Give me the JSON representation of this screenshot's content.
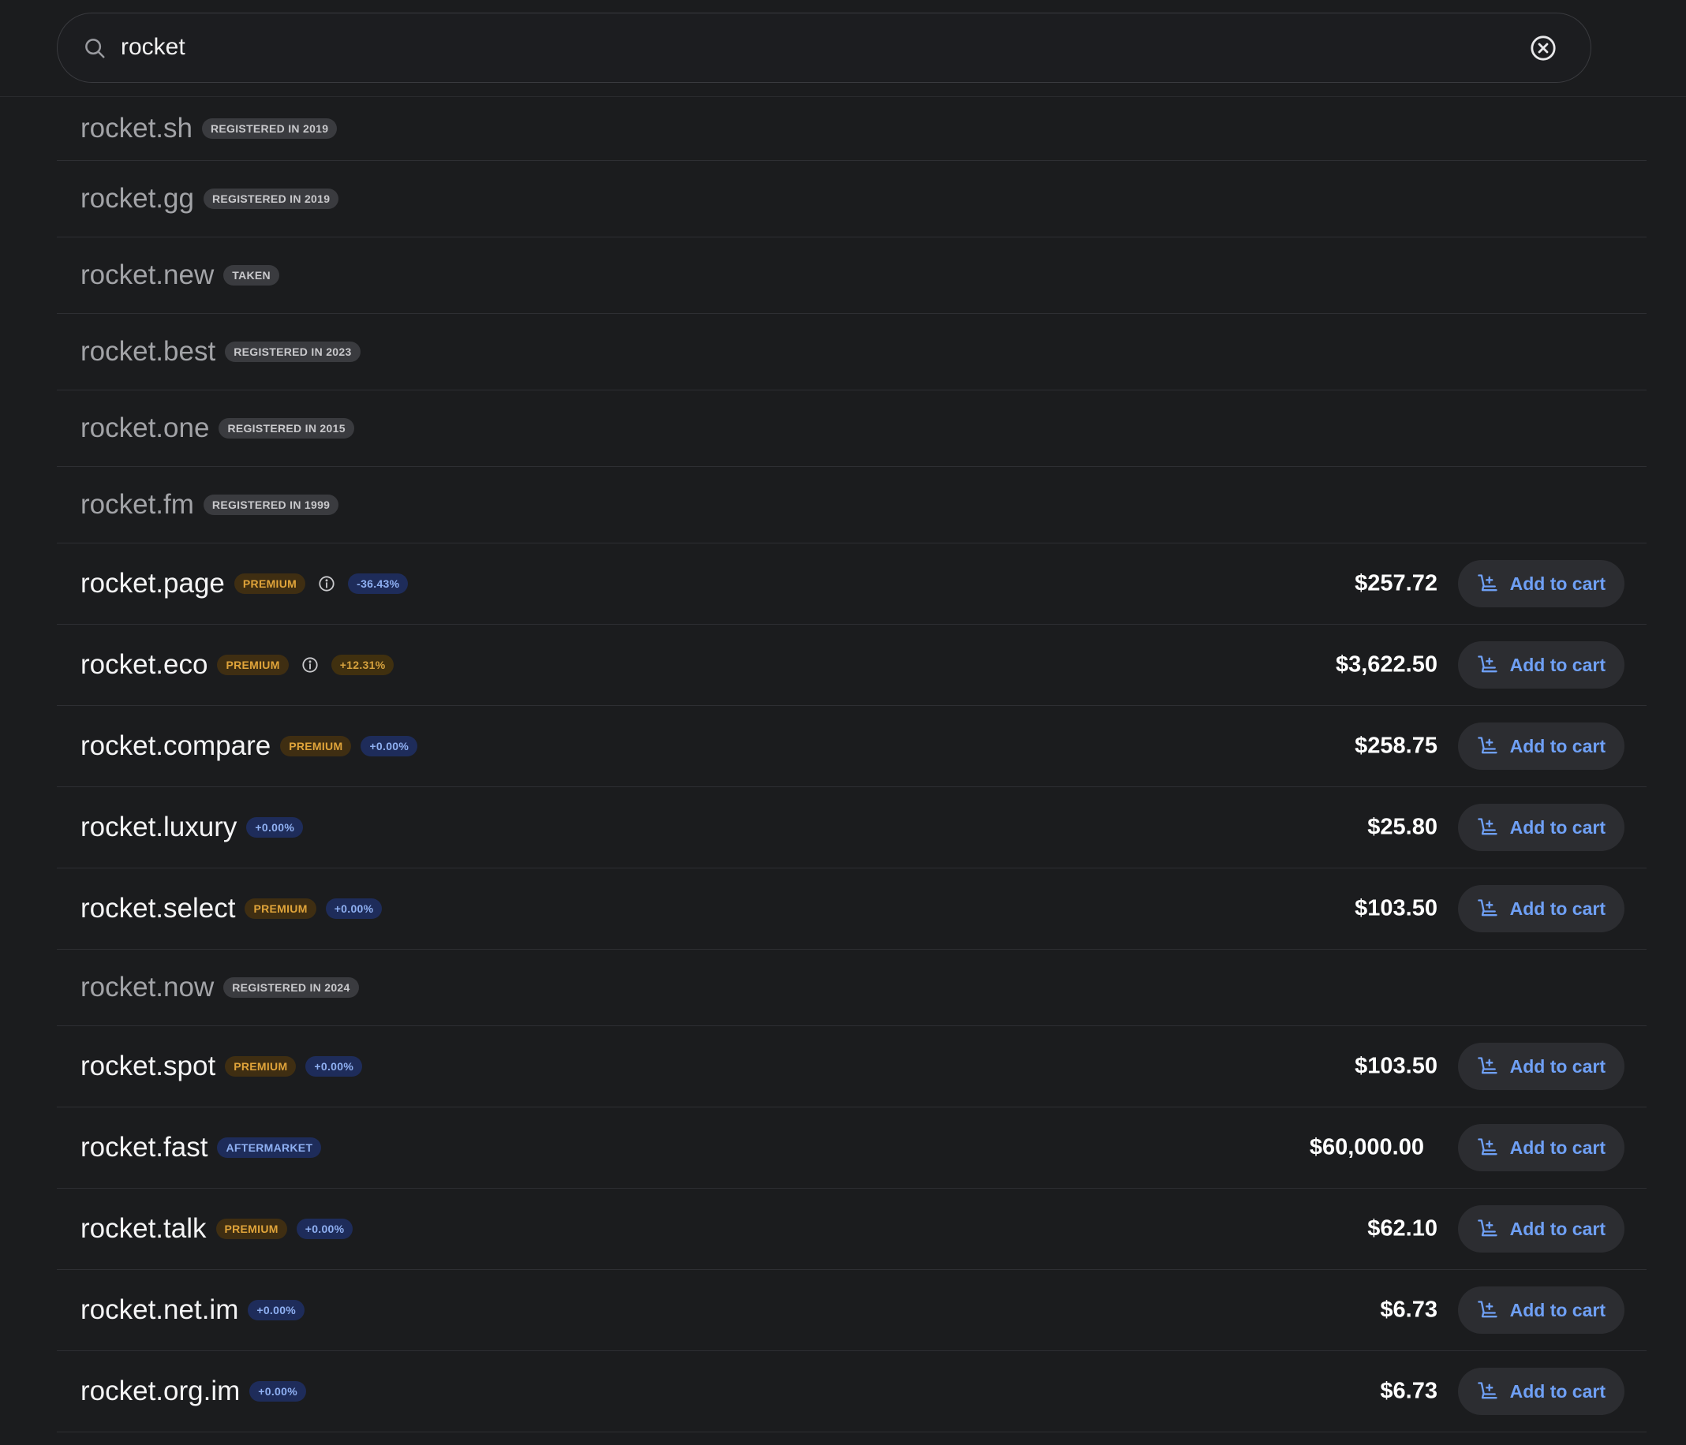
{
  "search": {
    "value": "rocket"
  },
  "rows": [
    {
      "domain": "rocket.sh",
      "status": "taken",
      "badges": [
        {
          "text": "REGISTERED IN 2019",
          "kind": "gray"
        }
      ]
    },
    {
      "domain": "rocket.gg",
      "status": "taken",
      "badges": [
        {
          "text": "REGISTERED IN 2019",
          "kind": "gray"
        }
      ]
    },
    {
      "domain": "rocket.new",
      "status": "taken",
      "badges": [
        {
          "text": "TAKEN",
          "kind": "gray"
        }
      ]
    },
    {
      "domain": "rocket.best",
      "status": "taken",
      "badges": [
        {
          "text": "REGISTERED IN 2023",
          "kind": "gray"
        }
      ]
    },
    {
      "domain": "rocket.one",
      "status": "taken",
      "badges": [
        {
          "text": "REGISTERED IN 2015",
          "kind": "gray"
        }
      ]
    },
    {
      "domain": "rocket.fm",
      "status": "taken",
      "badges": [
        {
          "text": "REGISTERED IN 1999",
          "kind": "gray"
        }
      ]
    },
    {
      "domain": "rocket.page",
      "status": "available",
      "badges": [
        {
          "text": "PREMIUM",
          "kind": "premium"
        },
        {
          "text": "-36.43%",
          "kind": "blue"
        }
      ],
      "info": true,
      "price": "$257.72",
      "cart_label": "Add to cart"
    },
    {
      "domain": "rocket.eco",
      "status": "available",
      "badges": [
        {
          "text": "PREMIUM",
          "kind": "premium"
        },
        {
          "text": "+12.31%",
          "kind": "orange"
        }
      ],
      "info": true,
      "price": "$3,622.50",
      "cart_label": "Add to cart"
    },
    {
      "domain": "rocket.compare",
      "status": "available",
      "badges": [
        {
          "text": "PREMIUM",
          "kind": "premium"
        },
        {
          "text": "+0.00%",
          "kind": "blue"
        }
      ],
      "price": "$258.75",
      "cart_label": "Add to cart"
    },
    {
      "domain": "rocket.luxury",
      "status": "available",
      "badges": [
        {
          "text": "+0.00%",
          "kind": "blue"
        }
      ],
      "price": "$25.80",
      "cart_label": "Add to cart"
    },
    {
      "domain": "rocket.select",
      "status": "available",
      "badges": [
        {
          "text": "PREMIUM",
          "kind": "premium"
        },
        {
          "text": "+0.00%",
          "kind": "blue"
        }
      ],
      "price": "$103.50",
      "cart_label": "Add to cart"
    },
    {
      "domain": "rocket.now",
      "status": "taken",
      "badges": [
        {
          "text": "REGISTERED IN 2024",
          "kind": "gray"
        }
      ]
    },
    {
      "domain": "rocket.spot",
      "status": "available",
      "badges": [
        {
          "text": "PREMIUM",
          "kind": "premium"
        },
        {
          "text": "+0.00%",
          "kind": "blue"
        }
      ],
      "price": "$103.50",
      "cart_label": "Add to cart"
    },
    {
      "domain": "rocket.fast",
      "status": "available",
      "badges": [
        {
          "text": "AFTERMARKET",
          "kind": "blue"
        }
      ],
      "price": "$60,000.00",
      "cart_label": "Add to cart",
      "wide": true
    },
    {
      "domain": "rocket.talk",
      "status": "available",
      "badges": [
        {
          "text": "PREMIUM",
          "kind": "premium"
        },
        {
          "text": "+0.00%",
          "kind": "blue"
        }
      ],
      "price": "$62.10",
      "cart_label": "Add to cart"
    },
    {
      "domain": "rocket.net.im",
      "status": "available",
      "badges": [
        {
          "text": "+0.00%",
          "kind": "blue"
        }
      ],
      "price": "$6.73",
      "cart_label": "Add to cart"
    },
    {
      "domain": "rocket.org.im",
      "status": "available",
      "badges": [
        {
          "text": "+0.00%",
          "kind": "blue"
        }
      ],
      "price": "$6.73",
      "cart_label": "Add to cart"
    }
  ],
  "icons": {
    "search": "search-icon",
    "clear": "clear-circle-x-icon",
    "cart": "cart-add-icon",
    "info": "info-circle-icon"
  },
  "colors": {
    "background": "#1b1c1e",
    "accent": "#6fa0f5",
    "premium": "#e0a43a"
  }
}
